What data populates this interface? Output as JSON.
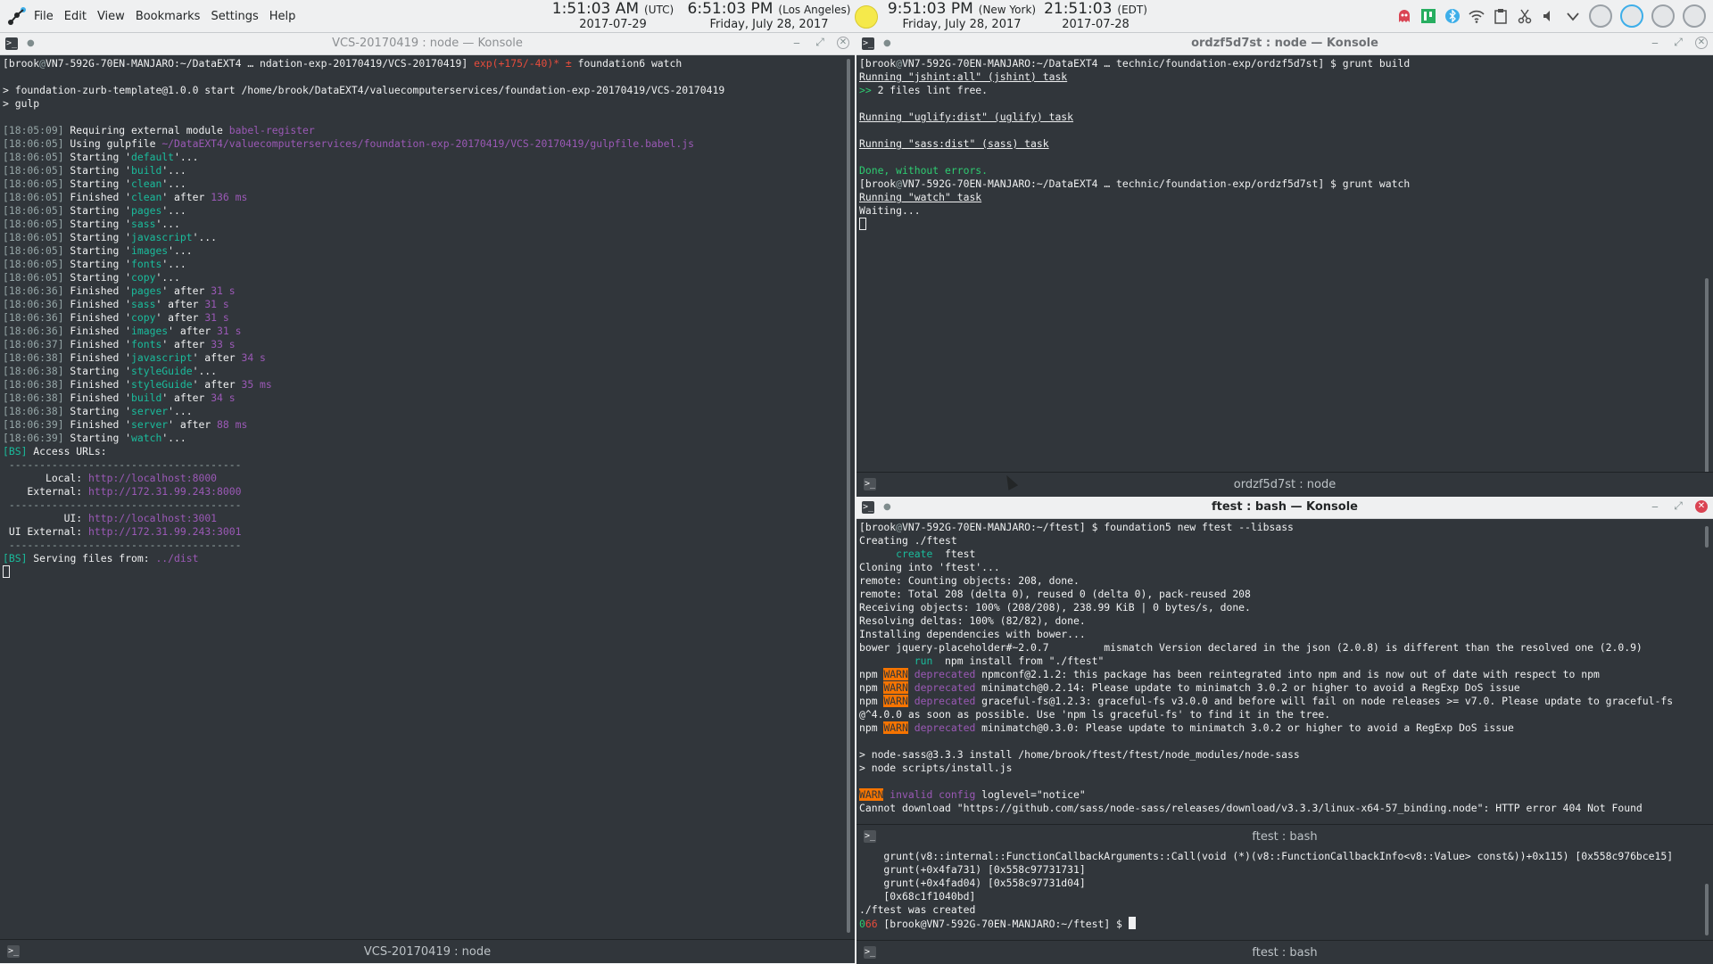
{
  "panel": {
    "menu": [
      "File",
      "Edit",
      "View",
      "Bookmarks",
      "Settings",
      "Help"
    ],
    "clocks": [
      {
        "time": "1:51:03 AM",
        "zone": "(UTC)",
        "date": "2017-07-29"
      },
      {
        "time": "6:51:03 PM",
        "zone": "(Los Angeles)",
        "date": "Friday, July 28, 2017"
      },
      {
        "time": "9:51:03 PM",
        "zone": "(New York)",
        "date": "Friday, July 28, 2017"
      },
      {
        "time": "21:51:03",
        "zone": "(EDT)",
        "date": "2017-07-28"
      }
    ]
  },
  "left_window": {
    "title": "VCS-20170419 : node — Konsole",
    "tab_label": "VCS-20170419 : node",
    "prompt": {
      "user": "brook",
      "host": "VN7-592G-70EN-MANJARO",
      "path": ":~/DataEXT4 … ndation-exp-20170419/VCS-20170419]",
      "branch": "exp(+175/-40)",
      "mark": "* ±",
      "cmd": "foundation6 watch"
    },
    "start_line": "> foundation-zurb-template@1.0.0 start /home/brook/DataEXT4/valuecomputerservices/foundation-exp-20170419/VCS-20170419",
    "gulp_line": "> gulp",
    "log": [
      {
        "time": "[18:05:09]",
        "pre": " Requiring external module ",
        "hl": "babel-register",
        "post": "",
        "cls": "p"
      },
      {
        "time": "[18:06:05]",
        "pre": " Using gulpfile ",
        "hl": "~/DataEXT4/valuecomputerservices/foundation-exp-20170419/VCS-20170419/gulpfile.babel.js",
        "post": "",
        "cls": "p"
      },
      {
        "time": "[18:06:05]",
        "pre": " Starting '",
        "hl": "default",
        "post": "'...",
        "cls": "g"
      },
      {
        "time": "[18:06:05]",
        "pre": " Starting '",
        "hl": "build",
        "post": "'...",
        "cls": "g"
      },
      {
        "time": "[18:06:05]",
        "pre": " Starting '",
        "hl": "clean",
        "post": "'...",
        "cls": "g"
      },
      {
        "time": "[18:06:05]",
        "pre": " Finished '",
        "hl": "clean",
        "post": "' after ",
        "dur": "136 ms",
        "cls": "g"
      },
      {
        "time": "[18:06:05]",
        "pre": " Starting '",
        "hl": "pages",
        "post": "'...",
        "cls": "g"
      },
      {
        "time": "[18:06:05]",
        "pre": " Starting '",
        "hl": "sass",
        "post": "'...",
        "cls": "g"
      },
      {
        "time": "[18:06:05]",
        "pre": " Starting '",
        "hl": "javascript",
        "post": "'...",
        "cls": "g"
      },
      {
        "time": "[18:06:05]",
        "pre": " Starting '",
        "hl": "images",
        "post": "'...",
        "cls": "g"
      },
      {
        "time": "[18:06:05]",
        "pre": " Starting '",
        "hl": "fonts",
        "post": "'...",
        "cls": "g"
      },
      {
        "time": "[18:06:05]",
        "pre": " Starting '",
        "hl": "copy",
        "post": "'...",
        "cls": "g"
      },
      {
        "time": "[18:06:36]",
        "pre": " Finished '",
        "hl": "pages",
        "post": "' after ",
        "dur": "31 s",
        "cls": "g"
      },
      {
        "time": "[18:06:36]",
        "pre": " Finished '",
        "hl": "sass",
        "post": "' after ",
        "dur": "31 s",
        "cls": "g"
      },
      {
        "time": "[18:06:36]",
        "pre": " Finished '",
        "hl": "copy",
        "post": "' after ",
        "dur": "31 s",
        "cls": "g"
      },
      {
        "time": "[18:06:36]",
        "pre": " Finished '",
        "hl": "images",
        "post": "' after ",
        "dur": "31 s",
        "cls": "g"
      },
      {
        "time": "[18:06:37]",
        "pre": " Finished '",
        "hl": "fonts",
        "post": "' after ",
        "dur": "33 s",
        "cls": "g"
      },
      {
        "time": "[18:06:38]",
        "pre": " Finished '",
        "hl": "javascript",
        "post": "' after ",
        "dur": "34 s",
        "cls": "g"
      },
      {
        "time": "[18:06:38]",
        "pre": " Starting '",
        "hl": "styleGuide",
        "post": "'...",
        "cls": "g"
      },
      {
        "time": "[18:06:38]",
        "pre": " Finished '",
        "hl": "styleGuide",
        "post": "' after ",
        "dur": "35 ms",
        "cls": "g"
      },
      {
        "time": "[18:06:38]",
        "pre": " Finished '",
        "hl": "build",
        "post": "' after ",
        "dur": "34 s",
        "cls": "g"
      },
      {
        "time": "[18:06:38]",
        "pre": " Starting '",
        "hl": "server",
        "post": "'...",
        "cls": "g"
      },
      {
        "time": "[18:06:39]",
        "pre": " Finished '",
        "hl": "server",
        "post": "' after ",
        "dur": "88 ms",
        "cls": "g"
      },
      {
        "time": "[18:06:39]",
        "pre": " Starting '",
        "hl": "watch",
        "post": "'...",
        "cls": "g"
      }
    ],
    "bs_access": "[BS] Access URLs:",
    "divider": " --------------------------------------",
    "local_label": "       Local: ",
    "local_url": "http://localhost:8000",
    "external_label": "    External: ",
    "external_url": "http://172.31.99.243:8000",
    "ui_label": "          UI: ",
    "ui_url": "http://localhost:3001",
    "ui_external_label": " UI External: ",
    "ui_external_url": "http://172.31.99.243:3001",
    "serving_label": "[BS] Serving files from: ",
    "serving_path": "../dist"
  },
  "right_top_window": {
    "title": "ordzf5d7st : node — Konsole",
    "tab_label": "ordzf5d7st : node",
    "prompt_user": "brook",
    "prompt_host": "VN7-592G-70EN-MANJARO",
    "prompt_path": ":~/DataEXT4 … technic/foundation-exp/ordzf5d7st] $ ",
    "cmd1": "grunt build",
    "line_jshint": "Running \"jshint:all\" (jshint) task",
    "line_lint": ">> ",
    "line_lint_rest": "2 files lint free.",
    "line_uglify": "Running \"uglify:dist\" (uglify) task",
    "line_sass": "Running \"sass:dist\" (sass) task",
    "line_done": "Done, without errors.",
    "cmd2": "grunt watch",
    "line_watch": "Running \"watch\" task",
    "line_waiting": "Waiting..."
  },
  "right_bottom_window": {
    "title": "ftest : bash — Konsole",
    "tab_label_1": "ftest : bash",
    "tab_label_2": "ftest : bash",
    "prompt_user": "brook",
    "prompt_host": "VN7-592G-70EN-MANJARO",
    "prompt_path": ":~/ftest] $ ",
    "cmd": "foundation5 new ftest --libsass",
    "lines": [
      "Creating ./ftest",
      "Cloning into 'ftest'...",
      "remote: Counting objects: 208, done.",
      "remote: Total 208 (delta 0), reused 0 (delta 0), pack-reused 208",
      "Receiving objects: 100% (208/208), 238.99 KiB | 0 bytes/s, done.",
      "Resolving deltas: 100% (82/82), done.",
      "Installing dependencies with bower...",
      "bower jquery-placeholder#~2.0.7         mismatch Version declared in the json (2.0.8) is different than the resolved one (2.0.9)"
    ],
    "create_word": "create",
    "create_target": "ftest",
    "run_word": "run",
    "run_rest": "npm install from \"./ftest\"",
    "npm_warns": [
      "npmconf@2.1.2: this package has been reintegrated into npm and is now out of date with respect to npm",
      "minimatch@0.2.14: Please update to minimatch 3.0.2 or higher to avoid a RegExp DoS issue",
      "graceful-fs@1.2.3: graceful-fs v3.0.0 and before will fail on node releases >= v7.0. Please update to graceful-fs",
      "minimatch@0.3.0: Please update to minimatch 3.0.2 or higher to avoid a RegExp DoS issue"
    ],
    "graceful_cont": "@^4.0.0 as soon as possible. Use 'npm ls graceful-fs' to find it in the tree.",
    "node_sass_line": "> node-sass@3.3.3 install /home/brook/ftest/ftest/node_modules/node-sass",
    "node_scripts_line": "> node scripts/install.js",
    "warn_config": "invalid config",
    "warn_rest": " loglevel=\"notice\"",
    "cannot_download": "Cannot download \"https://github.com/sass/node-sass/releases/download/v3.3.3/linux-x64-57_binding.node\": HTTP error 404 Not Found",
    "stack": [
      "    grunt(v8::internal::FunctionCallbackArguments::Call(void (*)(v8::FunctionCallbackInfo<v8::Value> const&))+0x115) [0x558c976bce15]",
      "    grunt(+0x4fa731) [0x558c97731731]",
      "    grunt(+0x4fad04) [0x558c97731d04]",
      "    [0x68c1f1040bd]"
    ],
    "created_line": "./ftest was created",
    "last_status": "0",
    "last_status2": "66",
    "last_prompt_tail": " [brook@VN7-592G-70EN-MANJARO:~/ftest] $ "
  },
  "colors": {
    "terminal_bg": "#31363b",
    "purple": "#9b59b6",
    "teal": "#1abc9c",
    "warn_orange": "#f67400",
    "close_red": "#da4453"
  }
}
